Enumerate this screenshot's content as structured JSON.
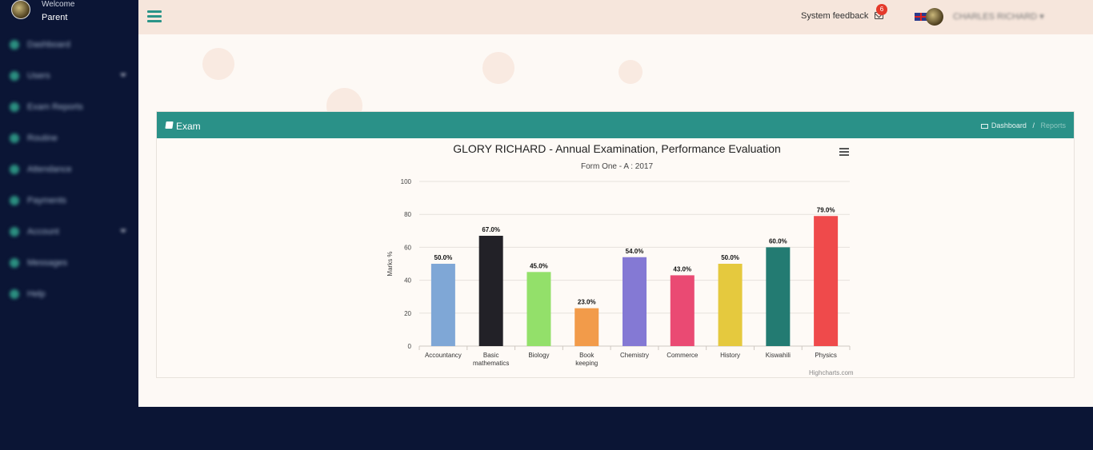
{
  "sidebar": {
    "welcome": "Welcome",
    "role": "Parent",
    "items": [
      {
        "label": "Dashboard",
        "icon": "dashboard-icon"
      },
      {
        "label": "Users",
        "icon": "users-icon",
        "has_caret": true
      },
      {
        "label": "Exam Reports",
        "icon": "exam-icon"
      },
      {
        "label": "Routine",
        "icon": "routine-icon"
      },
      {
        "label": "Attendance",
        "icon": "attendance-icon"
      },
      {
        "label": "Payments",
        "icon": "payments-icon"
      },
      {
        "label": "Account",
        "icon": "account-icon",
        "has_caret": true
      },
      {
        "label": "Messages",
        "icon": "messages-icon"
      },
      {
        "label": "Help",
        "icon": "help-icon"
      }
    ]
  },
  "topbar": {
    "feedback_label": "System feedback",
    "notification_count": "6",
    "user_name": "CHARLES RICHARD"
  },
  "panel": {
    "title": "Exam",
    "breadcrumb": {
      "home": "Dashboard",
      "separator": "/",
      "current": "Reports"
    }
  },
  "chart_data": {
    "type": "bar",
    "title": "GLORY RICHARD - Annual Examination, Performance Evaluation",
    "subtitle": "Form One - A : 2017",
    "ylabel": "Marks %",
    "ylim": [
      0,
      100
    ],
    "yticks": [
      0,
      20,
      40,
      60,
      80,
      100
    ],
    "categories": [
      [
        "Accountancy"
      ],
      [
        "Basic",
        "mathematics"
      ],
      [
        "Biology"
      ],
      [
        "Book",
        "keeping"
      ],
      [
        "Chemistry"
      ],
      [
        "Commerce"
      ],
      [
        "History"
      ],
      [
        "Kiswahili"
      ],
      [
        "Physics"
      ]
    ],
    "values": [
      50,
      67,
      45,
      23,
      54,
      43,
      50,
      60,
      79
    ],
    "data_labels": [
      "50.0%",
      "67.0%",
      "45.0%",
      "23.0%",
      "54.0%",
      "43.0%",
      "50.0%",
      "60.0%",
      "79.0%"
    ],
    "colors": [
      "#7fa7d6",
      "#222127",
      "#93e06a",
      "#f29b4a",
      "#8479d4",
      "#ea4a73",
      "#e5c93e",
      "#237b72",
      "#ef4a4b"
    ],
    "credit": "Highcharts.com",
    "grid": true,
    "legend": "none"
  }
}
